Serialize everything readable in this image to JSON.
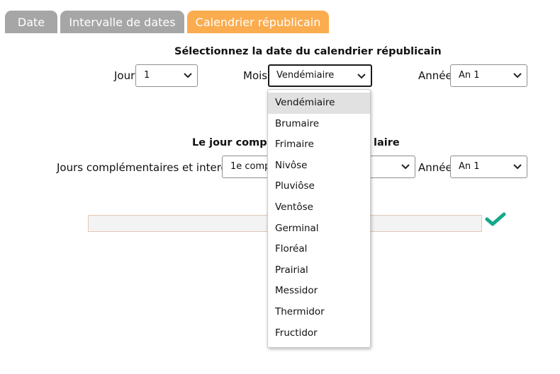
{
  "tabs": [
    {
      "label": "Date",
      "active": false
    },
    {
      "label": "Intervalle de dates",
      "active": false
    },
    {
      "label": "Calendrier républicain",
      "active": true
    }
  ],
  "colors": {
    "tab_inactive": "#a6a6a6",
    "tab_active": "#fbac4e",
    "check": "#15a88a"
  },
  "section1": {
    "heading": "Sélectionnez la date du calendrier républicain",
    "jour_label": "Jour",
    "jour_value": "1",
    "mois_label": "Mois",
    "mois_value": "Vendémiaire",
    "annee_label": "Année",
    "annee_value": "An 1"
  },
  "section2": {
    "heading_left": "Le jour complé",
    "heading_right": "laire",
    "jours_label": "Jours complémentaires et intercal",
    "jours_value": "1e comp",
    "annee_label": "Année",
    "annee_value": "An 1"
  },
  "result": {
    "value": "",
    "icon": "checkmark-icon"
  },
  "mois_dropdown": {
    "highlighted": "Vendémiaire",
    "options": [
      "Vendémiaire",
      "Brumaire",
      "Frimaire",
      "Nivôse",
      "Pluviôse",
      "Ventôse",
      "Germinal",
      "Floréal",
      "Prairial",
      "Messidor",
      "Thermidor",
      "Fructidor"
    ]
  }
}
